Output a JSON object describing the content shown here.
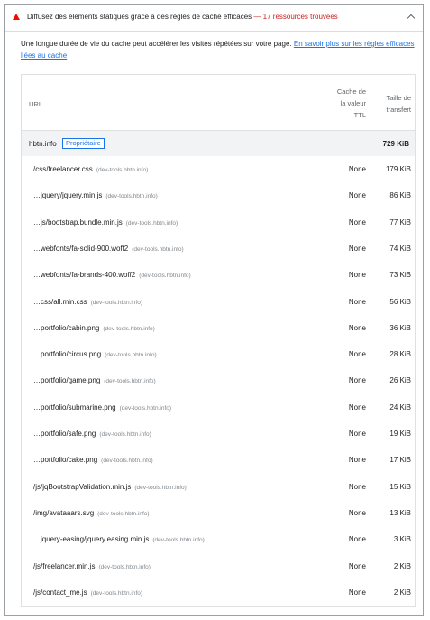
{
  "audit": {
    "title": "Diffusez des éléments statiques grâce à des règles de cache efficaces",
    "separator": "—",
    "count_label": "17 ressources trouvées",
    "description": "Une longue durée de vie du cache peut accélérer les visites répétées sur votre page.",
    "link_text": "En savoir plus sur les règles efficaces liées au cache",
    "status_color": "#eb0f00"
  },
  "table": {
    "headers": {
      "url": "URL",
      "cache_line1": "Cache de",
      "cache_line2": "la valeur",
      "cache_line3": "TTL",
      "size_line1": "Taille de",
      "size_line2": "transfert"
    },
    "group": {
      "name": "hbtn.info",
      "badge": "Propriétaire",
      "size": "729 KiB"
    },
    "rows": [
      {
        "url": "/css/freelancer.css",
        "host": "(dev-tools.hbtn.info)",
        "ttl": "None",
        "size": "179 KiB"
      },
      {
        "url": "…jquery/jquery.min.js",
        "host": "(dev-tools.hbtn.info)",
        "ttl": "None",
        "size": "86 KiB"
      },
      {
        "url": "…js/bootstrap.bundle.min.js",
        "host": "(dev-tools.hbtn.info)",
        "ttl": "None",
        "size": "77 KiB"
      },
      {
        "url": "…webfonts/fa-solid-900.woff2",
        "host": "(dev-tools.hbtn.info)",
        "ttl": "None",
        "size": "74 KiB"
      },
      {
        "url": "…webfonts/fa-brands-400.woff2",
        "host": "(dev-tools.hbtn.info)",
        "ttl": "None",
        "size": "73 KiB"
      },
      {
        "url": "…css/all.min.css",
        "host": "(dev-tools.hbtn.info)",
        "ttl": "None",
        "size": "56 KiB"
      },
      {
        "url": "…portfolio/cabin.png",
        "host": "(dev-tools.hbtn.info)",
        "ttl": "None",
        "size": "36 KiB"
      },
      {
        "url": "…portfolio/circus.png",
        "host": "(dev-tools.hbtn.info)",
        "ttl": "None",
        "size": "28 KiB"
      },
      {
        "url": "…portfolio/game.png",
        "host": "(dev-tools.hbtn.info)",
        "ttl": "None",
        "size": "26 KiB"
      },
      {
        "url": "…portfolio/submarine.png",
        "host": "(dev-tools.hbtn.info)",
        "ttl": "None",
        "size": "24 KiB"
      },
      {
        "url": "…portfolio/safe.png",
        "host": "(dev-tools.hbtn.info)",
        "ttl": "None",
        "size": "19 KiB"
      },
      {
        "url": "…portfolio/cake.png",
        "host": "(dev-tools.hbtn.info)",
        "ttl": "None",
        "size": "17 KiB"
      },
      {
        "url": "/js/jqBootstrapValidation.min.js",
        "host": "(dev-tools.hbtn.info)",
        "ttl": "None",
        "size": "15 KiB"
      },
      {
        "url": "/img/avataaars.svg",
        "host": "(dev-tools.hbtn.info)",
        "ttl": "None",
        "size": "13 KiB"
      },
      {
        "url": "…jquery-easing/jquery.easing.min.js",
        "host": "(dev-tools.hbtn.info)",
        "ttl": "None",
        "size": "3 KiB"
      },
      {
        "url": "/js/freelancer.min.js",
        "host": "(dev-tools.hbtn.info)",
        "ttl": "None",
        "size": "2 KiB"
      },
      {
        "url": "/js/contact_me.js",
        "host": "(dev-tools.hbtn.info)",
        "ttl": "None",
        "size": "2 KiB"
      }
    ]
  },
  "icons": {
    "status": "warning-triangle-icon",
    "toggle": "chevron-up-icon"
  }
}
